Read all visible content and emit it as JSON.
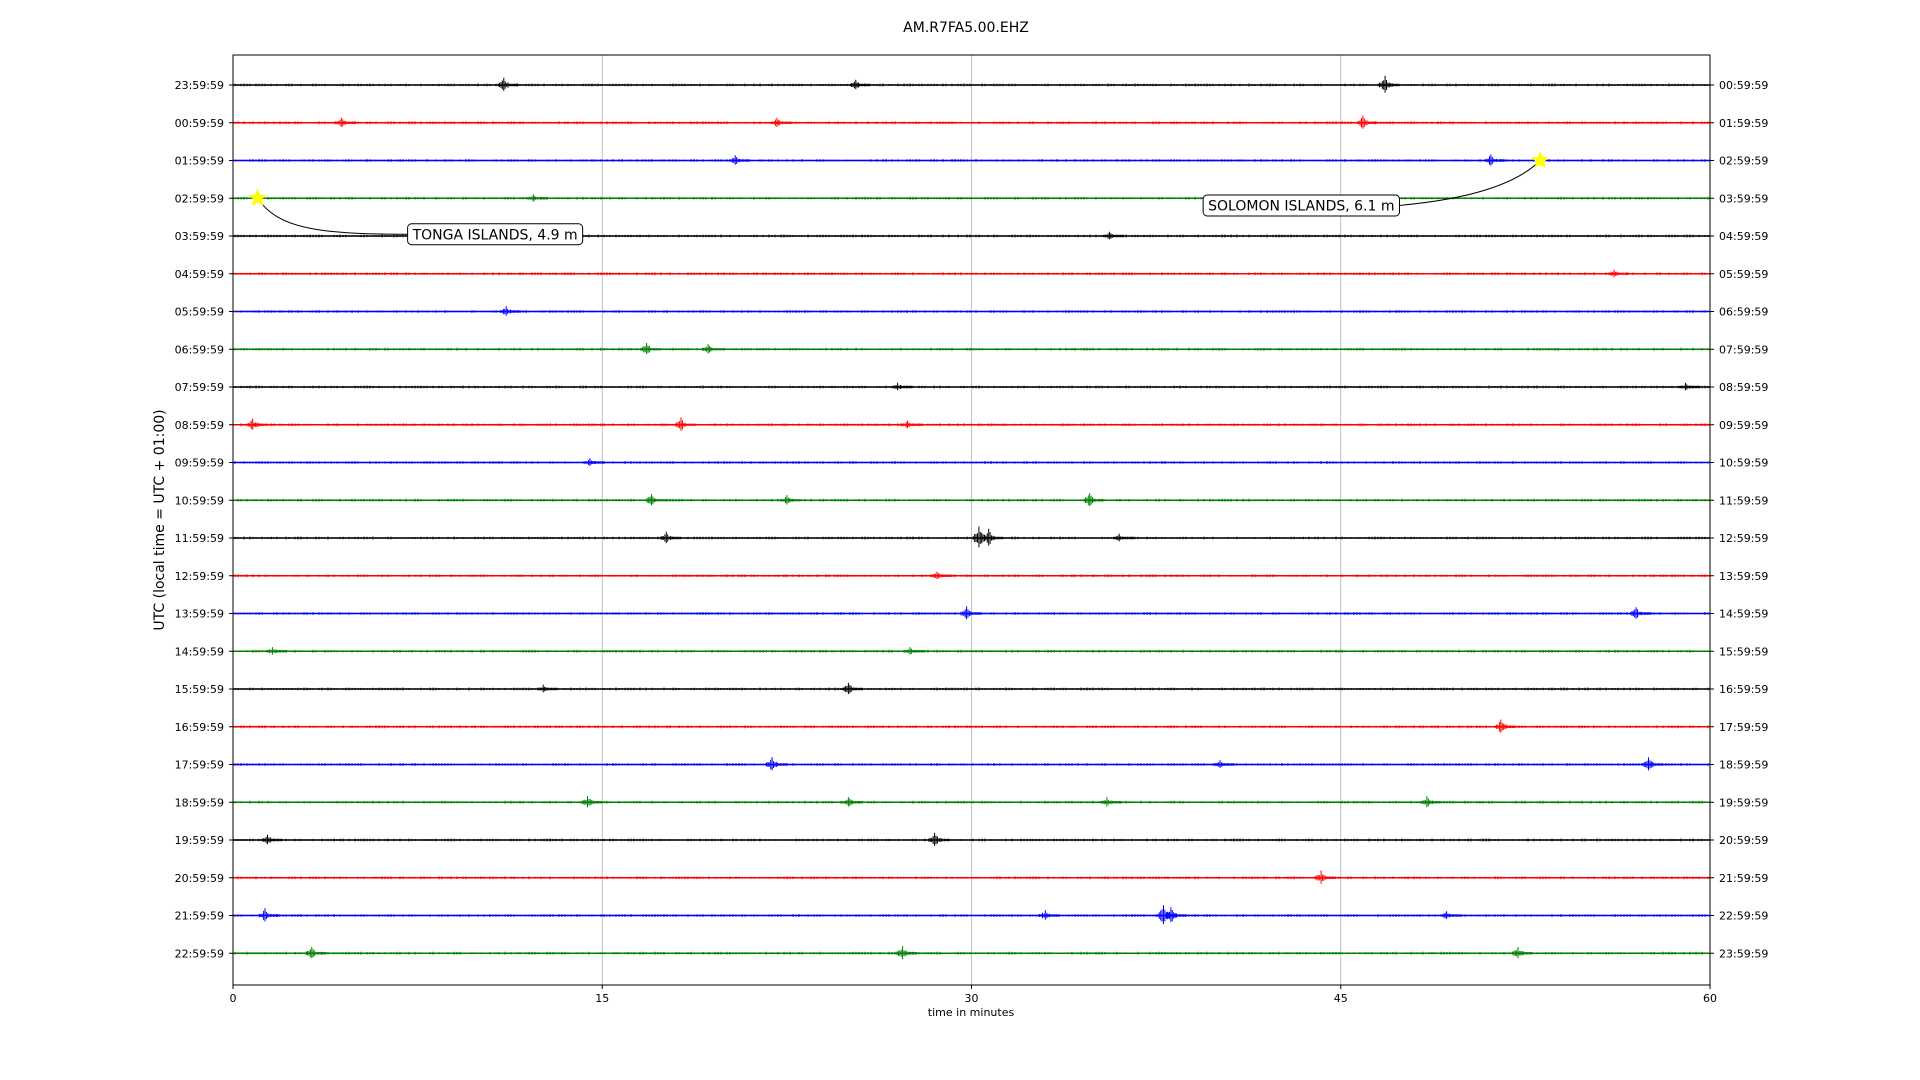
{
  "chart_data": {
    "type": "helicorder",
    "title": "AM.R7FA5.00.EHZ",
    "xlabel": "time in minutes",
    "ylabel": "UTC (local time = UTC + 01:00)",
    "xlim": [
      0,
      60
    ],
    "xticks": [
      0,
      15,
      30,
      45,
      60
    ],
    "grid_x": true,
    "trace_colors": [
      "#000000",
      "#ff0000",
      "#0000ff",
      "#008000"
    ],
    "left_labels": [
      "23:59:59",
      "00:59:59",
      "01:59:59",
      "02:59:59",
      "03:59:59",
      "04:59:59",
      "05:59:59",
      "06:59:59",
      "07:59:59",
      "08:59:59",
      "09:59:59",
      "10:59:59",
      "11:59:59",
      "12:59:59",
      "13:59:59",
      "14:59:59",
      "15:59:59",
      "16:59:59",
      "17:59:59",
      "18:59:59",
      "19:59:59",
      "20:59:59",
      "21:59:59",
      "22:59:59"
    ],
    "right_labels": [
      "00:59:59",
      "01:59:59",
      "02:59:59",
      "03:59:59",
      "04:59:59",
      "05:59:59",
      "06:59:59",
      "07:59:59",
      "08:59:59",
      "09:59:59",
      "10:59:59",
      "11:59:59",
      "12:59:59",
      "13:59:59",
      "14:59:59",
      "15:59:59",
      "16:59:59",
      "17:59:59",
      "18:59:59",
      "19:59:59",
      "20:59:59",
      "21:59:59",
      "22:59:59",
      "23:59:59"
    ],
    "events": [
      {
        "label": "TONGA ISLANDS, 4.9 m",
        "trace": 3,
        "minute": 1.0,
        "text_placement": "below-right",
        "marker_color": "#ffff00"
      },
      {
        "label": "SOLOMON ISLANDS, 6.1 m",
        "trace": 2,
        "minute": 53.1,
        "text_placement": "below-left",
        "marker_color": "#ffff00"
      }
    ],
    "spikes": [
      {
        "trace": 0,
        "minute": 11.0,
        "amp": 0.35
      },
      {
        "trace": 0,
        "minute": 25.3,
        "amp": 0.25
      },
      {
        "trace": 0,
        "minute": 46.8,
        "amp": 0.45
      },
      {
        "trace": 1,
        "minute": 4.4,
        "amp": 0.25
      },
      {
        "trace": 1,
        "minute": 22.1,
        "amp": 0.25
      },
      {
        "trace": 1,
        "minute": 45.9,
        "amp": 0.35
      },
      {
        "trace": 2,
        "minute": 20.4,
        "amp": 0.25
      },
      {
        "trace": 2,
        "minute": 51.1,
        "amp": 0.3
      },
      {
        "trace": 3,
        "minute": 12.2,
        "amp": 0.2
      },
      {
        "trace": 4,
        "minute": 35.6,
        "amp": 0.2
      },
      {
        "trace": 5,
        "minute": 56.1,
        "amp": 0.2
      },
      {
        "trace": 6,
        "minute": 11.1,
        "amp": 0.25
      },
      {
        "trace": 7,
        "minute": 16.8,
        "amp": 0.3
      },
      {
        "trace": 7,
        "minute": 19.3,
        "amp": 0.25
      },
      {
        "trace": 8,
        "minute": 27.0,
        "amp": 0.2
      },
      {
        "trace": 8,
        "minute": 59.0,
        "amp": 0.2
      },
      {
        "trace": 9,
        "minute": 0.8,
        "amp": 0.3
      },
      {
        "trace": 9,
        "minute": 18.2,
        "amp": 0.35
      },
      {
        "trace": 9,
        "minute": 27.4,
        "amp": 0.2
      },
      {
        "trace": 10,
        "minute": 14.5,
        "amp": 0.2
      },
      {
        "trace": 11,
        "minute": 17.0,
        "amp": 0.3
      },
      {
        "trace": 11,
        "minute": 22.5,
        "amp": 0.25
      },
      {
        "trace": 11,
        "minute": 34.8,
        "amp": 0.35
      },
      {
        "trace": 12,
        "minute": 17.6,
        "amp": 0.3
      },
      {
        "trace": 12,
        "minute": 30.3,
        "amp": 0.55
      },
      {
        "trace": 12,
        "minute": 30.7,
        "amp": 0.45
      },
      {
        "trace": 12,
        "minute": 36.0,
        "amp": 0.2
      },
      {
        "trace": 13,
        "minute": 28.6,
        "amp": 0.2
      },
      {
        "trace": 14,
        "minute": 29.8,
        "amp": 0.35
      },
      {
        "trace": 14,
        "minute": 57.0,
        "amp": 0.3
      },
      {
        "trace": 15,
        "minute": 1.6,
        "amp": 0.2
      },
      {
        "trace": 15,
        "minute": 27.5,
        "amp": 0.2
      },
      {
        "trace": 16,
        "minute": 25.0,
        "amp": 0.3
      },
      {
        "trace": 16,
        "minute": 12.6,
        "amp": 0.2
      },
      {
        "trace": 17,
        "minute": 51.5,
        "amp": 0.35
      },
      {
        "trace": 18,
        "minute": 21.9,
        "amp": 0.35
      },
      {
        "trace": 18,
        "minute": 57.5,
        "amp": 0.35
      },
      {
        "trace": 18,
        "minute": 40.1,
        "amp": 0.2
      },
      {
        "trace": 19,
        "minute": 14.4,
        "amp": 0.3
      },
      {
        "trace": 19,
        "minute": 25.0,
        "amp": 0.25
      },
      {
        "trace": 19,
        "minute": 35.5,
        "amp": 0.25
      },
      {
        "trace": 19,
        "minute": 48.5,
        "amp": 0.3
      },
      {
        "trace": 20,
        "minute": 1.4,
        "amp": 0.25
      },
      {
        "trace": 20,
        "minute": 28.5,
        "amp": 0.35
      },
      {
        "trace": 21,
        "minute": 44.2,
        "amp": 0.35
      },
      {
        "trace": 22,
        "minute": 1.3,
        "amp": 0.35
      },
      {
        "trace": 22,
        "minute": 33.0,
        "amp": 0.25
      },
      {
        "trace": 22,
        "minute": 37.8,
        "amp": 0.5
      },
      {
        "trace": 22,
        "minute": 38.1,
        "amp": 0.4
      },
      {
        "trace": 22,
        "minute": 49.3,
        "amp": 0.2
      },
      {
        "trace": 23,
        "minute": 3.2,
        "amp": 0.3
      },
      {
        "trace": 23,
        "minute": 27.2,
        "amp": 0.35
      },
      {
        "trace": 23,
        "minute": 52.2,
        "amp": 0.3
      }
    ]
  }
}
